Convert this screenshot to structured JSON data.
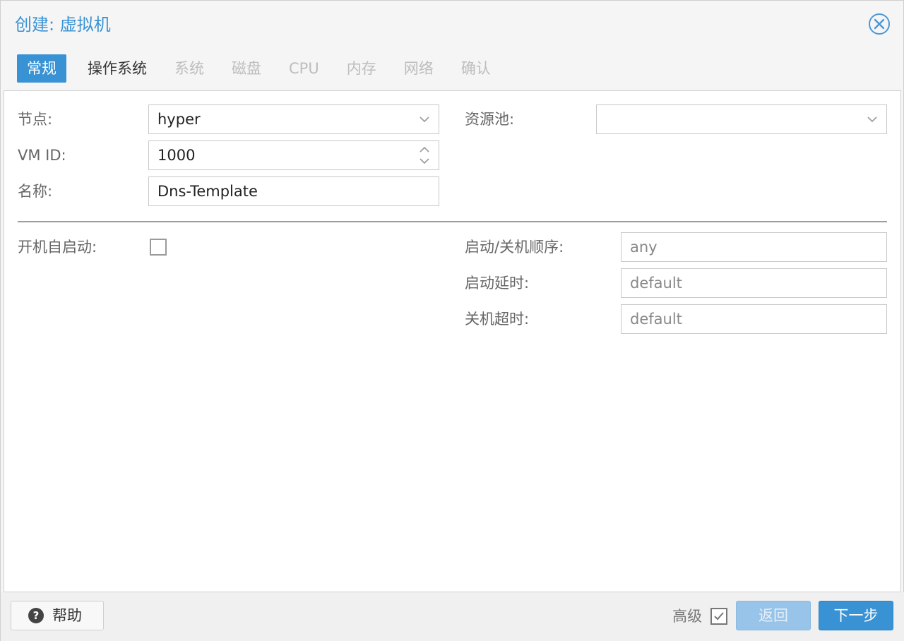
{
  "window": {
    "title": "创建: 虚拟机"
  },
  "tabs": [
    {
      "label": "常规",
      "state": "active"
    },
    {
      "label": "操作系统",
      "state": "enabled"
    },
    {
      "label": "系统",
      "state": "disabled"
    },
    {
      "label": "磁盘",
      "state": "disabled"
    },
    {
      "label": "CPU",
      "state": "disabled"
    },
    {
      "label": "内存",
      "state": "disabled"
    },
    {
      "label": "网络",
      "state": "disabled"
    },
    {
      "label": "确认",
      "state": "disabled"
    }
  ],
  "form": {
    "node": {
      "label": "节点:",
      "value": "hyper"
    },
    "vmid": {
      "label": "VM ID:",
      "value": "1000"
    },
    "name": {
      "label": "名称:",
      "value": "Dns-Template"
    },
    "pool": {
      "label": "资源池:",
      "value": ""
    },
    "onboot": {
      "label": "开机自启动:",
      "checked": false
    },
    "startup_order": {
      "label": "启动/关机顺序:",
      "placeholder": "any"
    },
    "startup_delay": {
      "label": "启动延时:",
      "placeholder": "default"
    },
    "shutdown_timeout": {
      "label": "关机超时:",
      "placeholder": "default"
    }
  },
  "footer": {
    "help_label": "帮助",
    "advanced_label": "高级",
    "advanced_checked": true,
    "back_label": "返回",
    "next_label": "下一步"
  },
  "colors": {
    "accent": "#3892d4",
    "disabled_button": "#99c4e9"
  }
}
